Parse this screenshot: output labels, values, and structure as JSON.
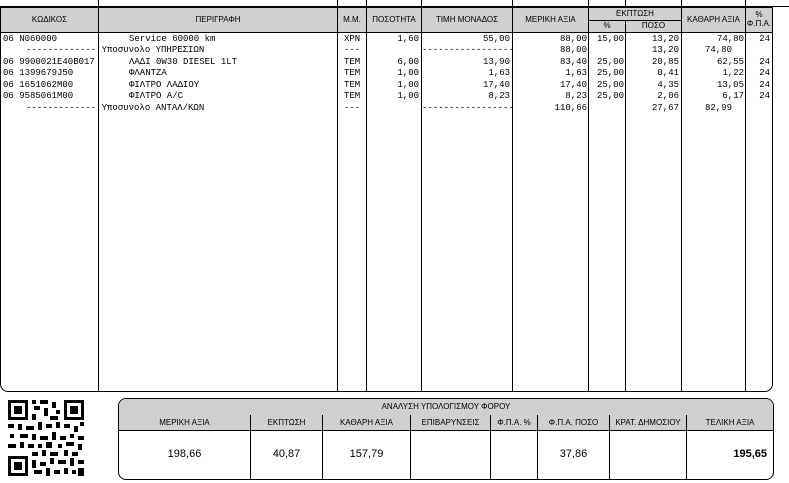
{
  "columns": {
    "code": "ΚΩΔΙΚΟΣ",
    "description": "ΠΕΡΙΓΡΑΦΗ",
    "unit": "Μ.Μ.",
    "quantity": "ΠΟΣΟΤΗΤΑ",
    "unit_price": "ΤΙΜΗ ΜΟΝΑΔΟΣ",
    "partial_value": "ΜΕΡΙΚΗ ΑΞΙΑ",
    "discount": "ΕΚΠΤΩΣΗ",
    "discount_pct": "%",
    "discount_amount": "ΠΟΣΟ",
    "net_value": "ΚΑΘΑΡΗ ΑΞΙΑ",
    "vat_pct_top": "%",
    "vat_pct_bottom": "Φ.Π.Α."
  },
  "rows": [
    {
      "code": "06 N060000",
      "desc": "Service 60000 km",
      "unit": "ΧΡΝ",
      "qty": "1,60",
      "price": "55,00",
      "partial": "88,00",
      "dpct": "15,00",
      "damt": "13,20",
      "net": "74,80",
      "vat": "24"
    },
    {
      "code": "",
      "desc": "------------- Υποσυνολο ΥΠΗΡΕΣΙΩΝ",
      "unit": "---",
      "qty": "",
      "price": "",
      "partial": "88,00",
      "dpct": "",
      "damt": "13,20",
      "net": "74,80",
      "vat": ""
    },
    {
      "code": "06 9900021E40B017",
      "desc": "ΛΑΔΙ 0W30 DIESEL 1LT",
      "unit": "ΤΕΜ",
      "qty": "6,00",
      "price": "13,90",
      "partial": "83,40",
      "dpct": "25,00",
      "damt": "20,85",
      "net": "62,55",
      "vat": "24"
    },
    {
      "code": "06 1399679J50",
      "desc": "ΦΛΑΝΤΖΑ",
      "unit": "ΤΕΜ",
      "qty": "1,00",
      "price": "1,63",
      "partial": "1,63",
      "dpct": "25,00",
      "damt": "0,41",
      "net": "1,22",
      "vat": "24"
    },
    {
      "code": "06 1651062M00",
      "desc": "ΦΙΛΤΡΟ ΛΑΔΙΟΥ",
      "unit": "ΤΕΜ",
      "qty": "1,00",
      "price": "17,40",
      "partial": "17,40",
      "dpct": "25,00",
      "damt": "4,35",
      "net": "13,05",
      "vat": "24"
    },
    {
      "code": "06 9585061M00",
      "desc": "ΦΙΛΤΡΟ A/C",
      "unit": "ΤΕΜ",
      "qty": "1,00",
      "price": "8,23",
      "partial": "8,23",
      "dpct": "25,00",
      "damt": "2,06",
      "net": "6,17",
      "vat": "24"
    },
    {
      "code": "",
      "desc": "------------- Υποσυνολο ΑΝΤΑΛ/ΚΩΝ",
      "unit": "---",
      "qty": "",
      "price": "",
      "partial": "110,66",
      "dpct": "",
      "damt": "27,67",
      "net": "82,99",
      "vat": ""
    }
  ],
  "leader_dashes": "-----------------",
  "tax": {
    "title": "ΑΝΑΛΥΣΗ ΥΠΟΛΟΓΙΣΜΟΥ ΦΟΡΟΥ",
    "headers": [
      "ΜΕΡΙΚΗ ΑΞΙΑ",
      "ΕΚΠΤΩΣΗ",
      "ΚΑΘΑΡΗ ΑΞΙΑ",
      "ΕΠΙΒΑΡΥΝΣΕΙΣ",
      "Φ.Π.Α. %",
      "Φ.Π.Α. ΠΟΣΟ",
      "ΚΡΑΤ. ΔΗΜΟΣΙΟΥ",
      "ΤΕΛΙΚΗ ΑΞΙΑ"
    ],
    "values": [
      "198,66",
      "40,87",
      "157,79",
      "",
      "",
      "37,86",
      "",
      "195,65"
    ]
  },
  "icons": {
    "qr": "qr-code-icon"
  }
}
